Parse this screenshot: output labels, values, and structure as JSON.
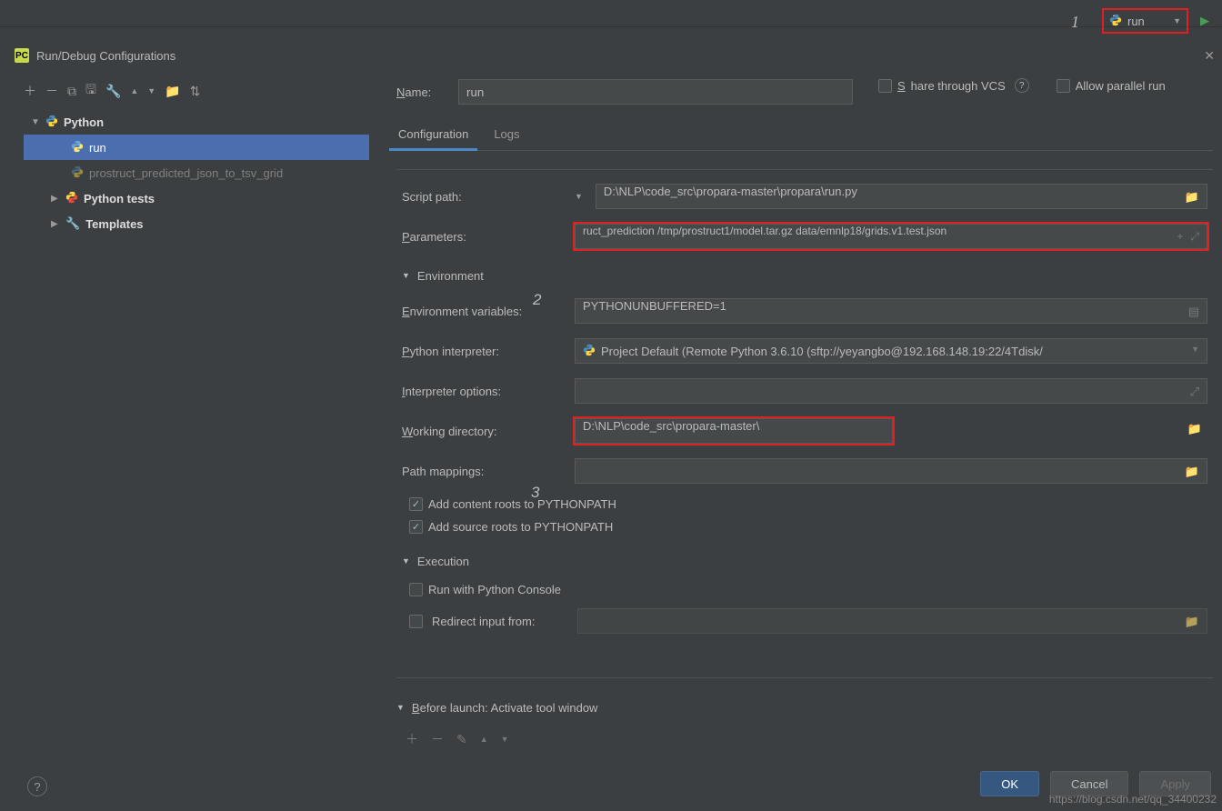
{
  "topbar": {
    "run_config_label": "run",
    "num1": "1"
  },
  "dialog": {
    "title": "Run/Debug Configurations",
    "name_label": "Name:",
    "name_value": "run",
    "share_label": "Share through VCS",
    "parallel_label": "Allow parallel run"
  },
  "tree": {
    "python": "Python",
    "run": "run",
    "prostruct": "prostruct_predicted_json_to_tsv_grid",
    "tests": "Python tests",
    "templates": "Templates"
  },
  "tabs": {
    "config": "Configuration",
    "logs": "Logs"
  },
  "form": {
    "script_path_label": "Script path:",
    "script_path_value": "D:\\NLP\\code_src\\propara-master\\propara\\run.py",
    "parameters_label": "Parameters:",
    "parameters_value": "ruct_prediction /tmp/prostruct1/model.tar.gz data/emnlp18/grids.v1.test.json",
    "num2": "2",
    "env_header": "Environment",
    "env_vars_label": "Environment variables:",
    "env_vars_value": "PYTHONUNBUFFERED=1",
    "interpreter_label": "Python interpreter:",
    "interpreter_value": "Project Default (Remote Python 3.6.10 (sftp://yeyangbo@192.168.148.19:22/4Tdisk/",
    "interp_opts_label": "Interpreter options:",
    "workdir_label": "Working directory:",
    "workdir_value": "D:\\NLP\\code_src\\propara-master\\",
    "num3": "3",
    "mappings_label": "Path mappings:",
    "add_content": "Add content roots to PYTHONPATH",
    "add_source": "Add source roots to PYTHONPATH",
    "exec_header": "Execution",
    "run_console": "Run with Python Console",
    "redirect_label": "Redirect input from:",
    "before_launch": "Before launch: Activate tool window"
  },
  "buttons": {
    "ok": "OK",
    "cancel": "Cancel",
    "apply": "Apply"
  },
  "watermark": "https://blog.csdn.net/qq_34400232"
}
